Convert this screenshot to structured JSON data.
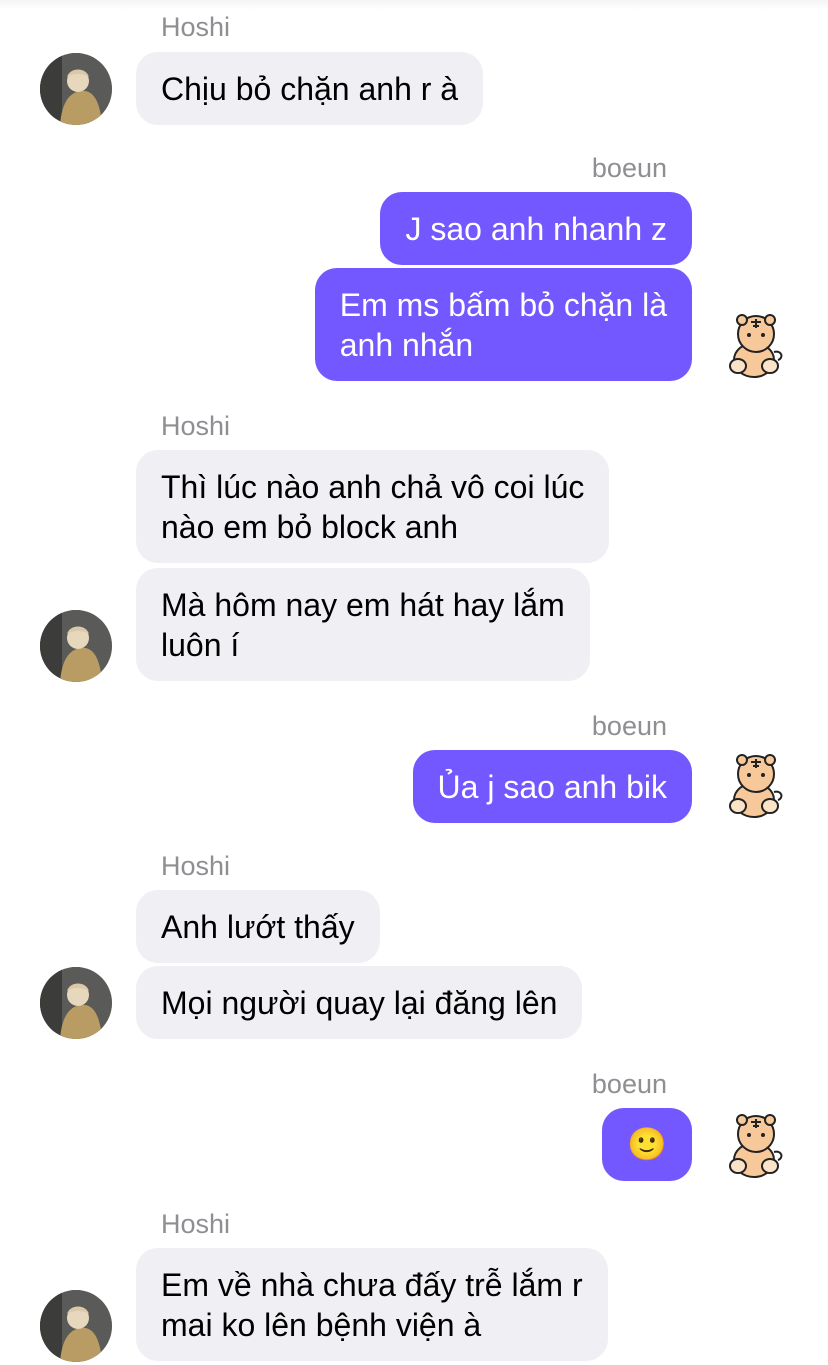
{
  "conversation": {
    "participants": {
      "other": "Hoshi",
      "self": "boeun"
    },
    "messages": [
      {
        "sender": "Hoshi",
        "text": "Chịu bỏ chặn anh r à"
      },
      {
        "sender": "boeun",
        "text": "J sao anh nhanh z"
      },
      {
        "sender": "boeun",
        "text": "Em ms bấm bỏ chặn là\nanh nhắn"
      },
      {
        "sender": "Hoshi",
        "text": "Thì lúc nào anh chả vô coi lúc\nnào em bỏ block anh"
      },
      {
        "sender": "Hoshi",
        "text": "Mà hôm nay em hát hay lắm\nluôn í"
      },
      {
        "sender": "boeun",
        "text": "Ủa j sao anh bik"
      },
      {
        "sender": "Hoshi",
        "text": "Anh lướt thấy"
      },
      {
        "sender": "Hoshi",
        "text": "Mọi người quay lại đăng lên"
      },
      {
        "sender": "boeun",
        "text": "🙂"
      },
      {
        "sender": "Hoshi",
        "text": "Em về nhà chưa đấy trễ lắm r\nmai ko lên bệnh viện à"
      }
    ]
  },
  "colors": {
    "outgoing_bubble": "#7357ff",
    "incoming_bubble": "#efeff4",
    "sender_name": "#8e8e93"
  },
  "icons": {
    "other_avatar": "user-photo-avatar",
    "self_avatar": "tiger-sticker-avatar"
  }
}
